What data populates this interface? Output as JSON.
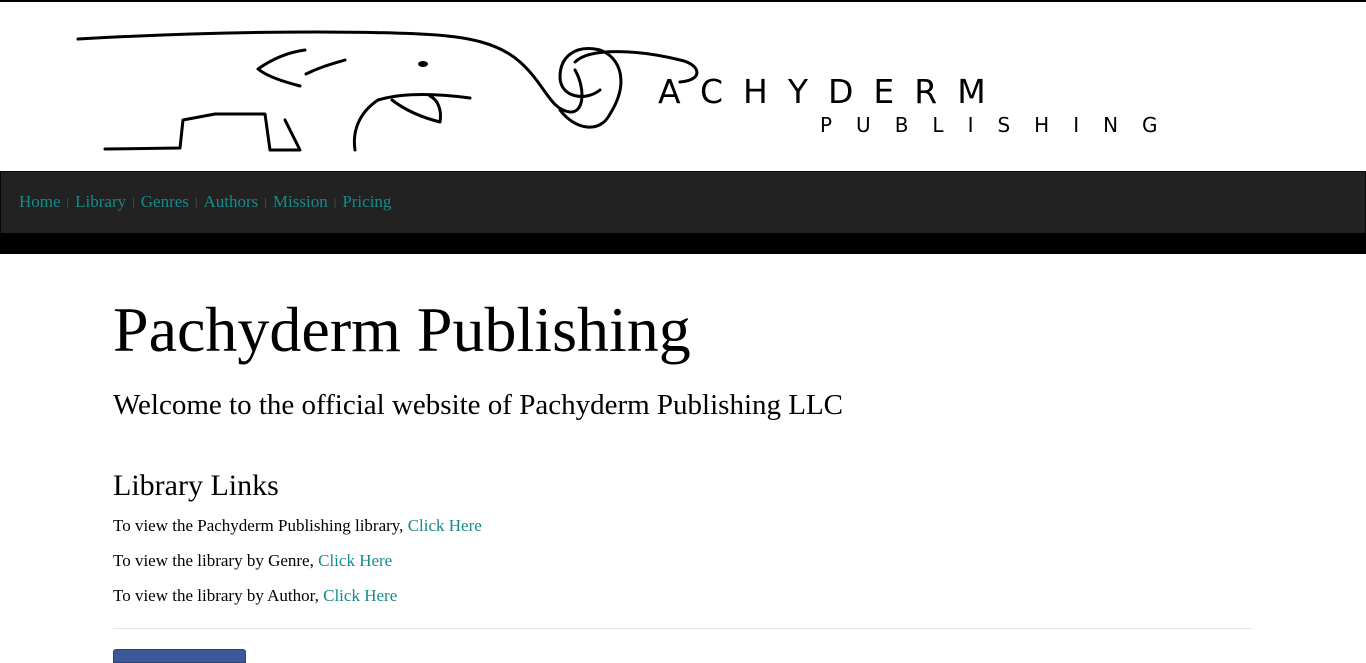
{
  "header": {
    "logo_word_main": "ACHYDERM",
    "logo_word_sub": "PUBLISHING"
  },
  "nav": {
    "items": [
      {
        "label": "Home"
      },
      {
        "label": "Library"
      },
      {
        "label": "Genres"
      },
      {
        "label": "Authors"
      },
      {
        "label": "Mission"
      },
      {
        "label": "Pricing"
      }
    ],
    "separator": "|"
  },
  "main": {
    "title": "Pachyderm Publishing",
    "welcome": "Welcome to the official website of Pachyderm Publishing LLC",
    "library_links": {
      "heading": "Library Links",
      "rows": [
        {
          "text": "To view the Pachyderm Publishing library, ",
          "link": "Click Here"
        },
        {
          "text": "To view the library by Genre, ",
          "link": "Click Here"
        },
        {
          "text": "To view the library by Author, ",
          "link": "Click Here"
        }
      ]
    }
  },
  "colors": {
    "link": "#168a8a",
    "navbar_bg": "#222222",
    "facebook_button": "#3b5998"
  },
  "icons": {
    "logo": "elephant-logo-icon"
  }
}
